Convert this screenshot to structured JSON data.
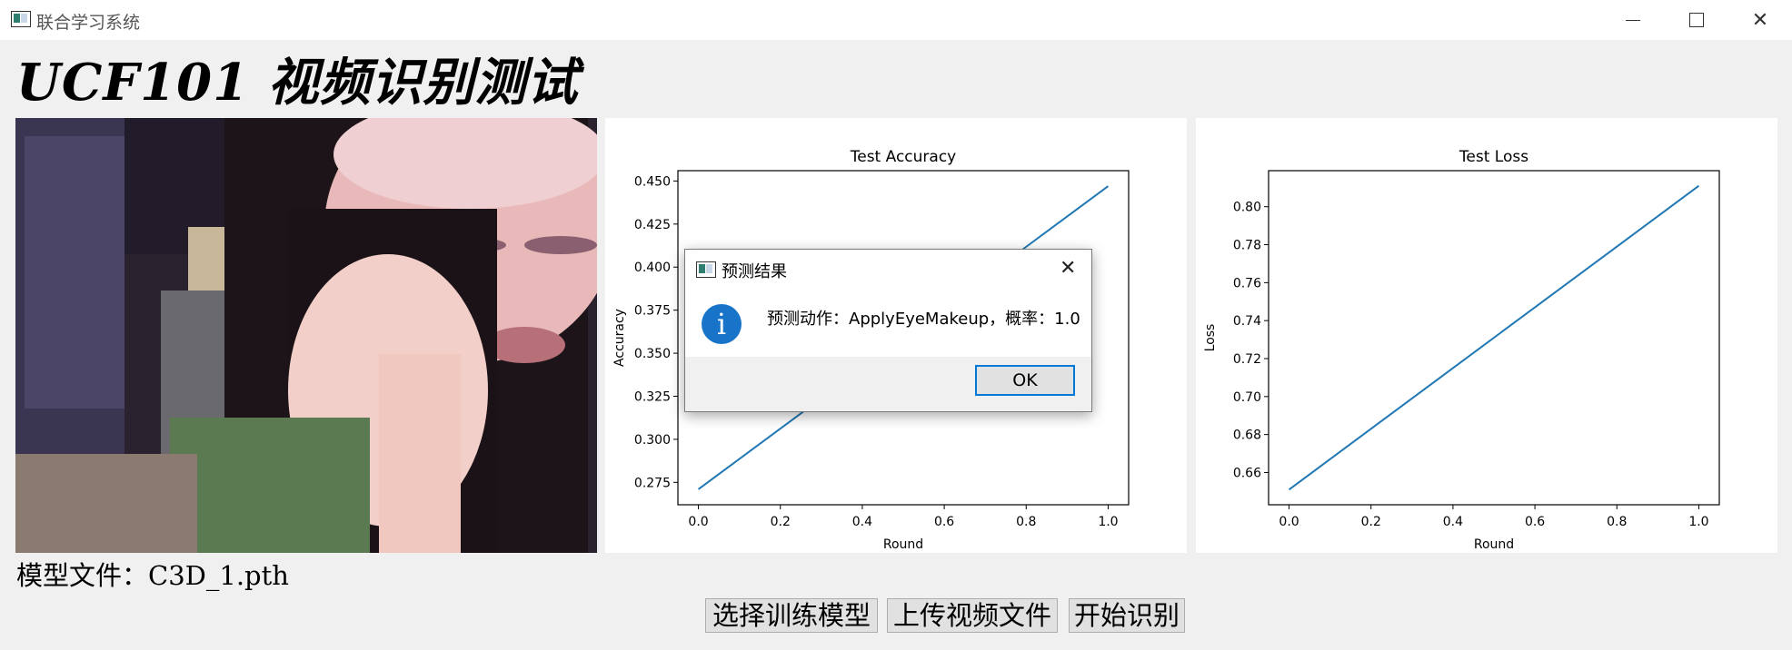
{
  "window": {
    "title": "联合学习系统"
  },
  "header": {
    "title": "UCF101 视频识别测试"
  },
  "charts": {
    "accuracy": {
      "title": "Test Accuracy",
      "xlabel": "Round",
      "ylabel": "Accuracy"
    },
    "loss": {
      "title": "Test Loss",
      "xlabel": "Round",
      "ylabel": "Loss"
    }
  },
  "chart_data": [
    {
      "type": "line",
      "title": "Test Accuracy",
      "xlabel": "Round",
      "ylabel": "Accuracy",
      "x": [
        0.0,
        1.0
      ],
      "series": [
        {
          "values": [
            0.271,
            0.447
          ]
        }
      ],
      "xticks": [
        "0.0",
        "0.2",
        "0.4",
        "0.6",
        "0.8",
        "1.0"
      ],
      "yticks": [
        "0.275",
        "0.300",
        "0.325",
        "0.350",
        "0.375",
        "0.400",
        "0.425",
        "0.450"
      ],
      "xlim": [
        -0.05,
        1.05
      ],
      "ylim": [
        0.262,
        0.456
      ],
      "color": "#1f77b4"
    },
    {
      "type": "line",
      "title": "Test Loss",
      "xlabel": "Round",
      "ylabel": "Loss",
      "x": [
        0.0,
        1.0
      ],
      "series": [
        {
          "values": [
            0.651,
            0.811
          ]
        }
      ],
      "xticks": [
        "0.0",
        "0.2",
        "0.4",
        "0.6",
        "0.8",
        "1.0"
      ],
      "yticks": [
        "0.66",
        "0.68",
        "0.70",
        "0.72",
        "0.74",
        "0.76",
        "0.78",
        "0.80"
      ],
      "xlim": [
        -0.05,
        1.05
      ],
      "ylim": [
        0.643,
        0.819
      ],
      "color": "#1f77b4"
    }
  ],
  "model": {
    "label": "模型文件：C3D_1.pth"
  },
  "buttons": {
    "select_model": "选择训练模型",
    "upload_video": "上传视频文件",
    "start": "开始识别"
  },
  "dialog": {
    "title": "预测结果",
    "message": "预测动作：ApplyEyeMakeup，概率：1.0",
    "ok": "OK"
  }
}
